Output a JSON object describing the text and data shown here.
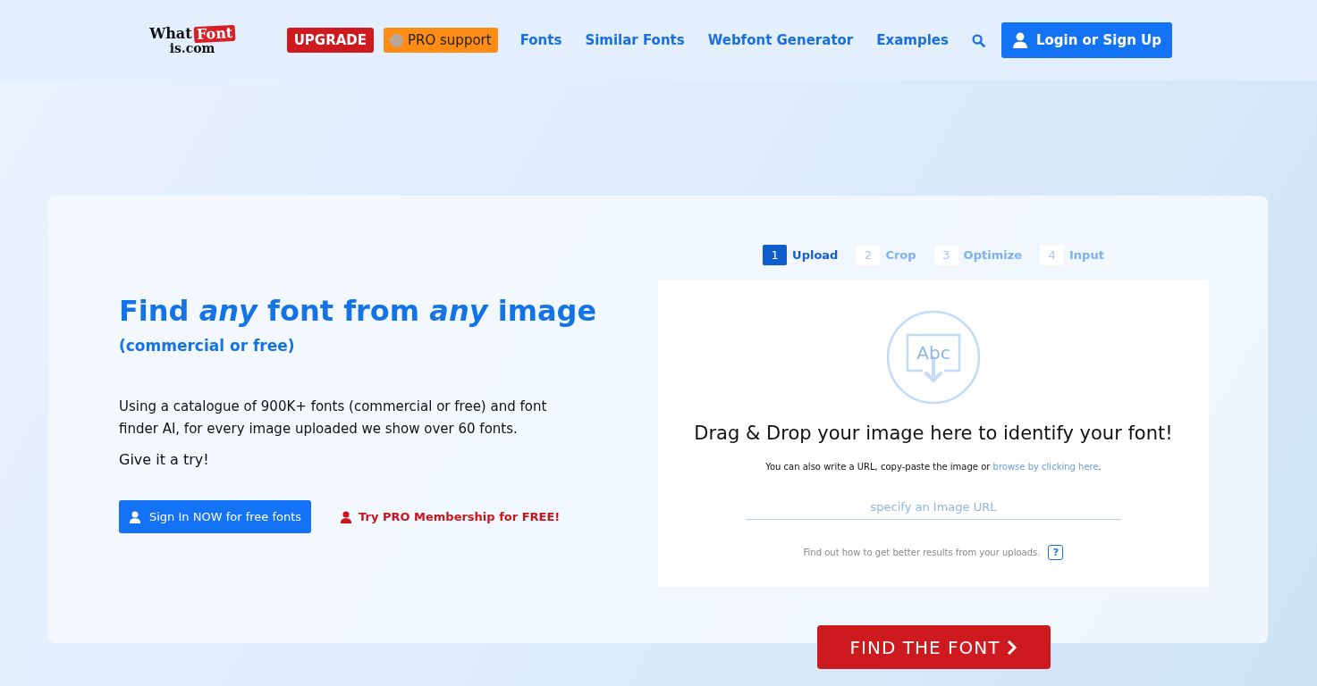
{
  "logo": {
    "word_1": "What",
    "word_2": "Font",
    "word_3": "is.com"
  },
  "nav": {
    "upgrade": "UPGRADE",
    "pro_support": "PRO support",
    "links": [
      "Fonts",
      "Similar Fonts",
      "Webfont Generator",
      "Examples"
    ],
    "login": "Login or Sign Up"
  },
  "hero": {
    "headline": "Find *any* font from *any* image",
    "subheadline": "(commercial or free)",
    "description": "Using a catalogue of 900K+ fonts (commercial or free) and font finder AI, for every image uploaded we show over 60 fonts.",
    "cta_text": "Give it a try!",
    "sign_in": "Sign In NOW for free fonts",
    "try_pro": "Try PRO Membership for FREE!"
  },
  "steps": [
    {
      "number": "1",
      "label": "Upload",
      "selected": true
    },
    {
      "number": "2",
      "label": "Crop",
      "selected": false
    },
    {
      "number": "3",
      "label": "Optimize",
      "selected": false
    },
    {
      "number": "4",
      "label": "Input",
      "selected": false
    }
  ],
  "upload": {
    "icon_text": "Abc",
    "title": "Drag & Drop your image here to identify your font!",
    "hint": "You can also write a URL, copy-paste the image or ",
    "hint_link": "browse by clicking here",
    "hint_end": ".",
    "url_placeholder": "specify an Image URL",
    "tips": "Find out how to get better results from your uploads.",
    "help": "?"
  },
  "find_button": "FIND THE FONT"
}
